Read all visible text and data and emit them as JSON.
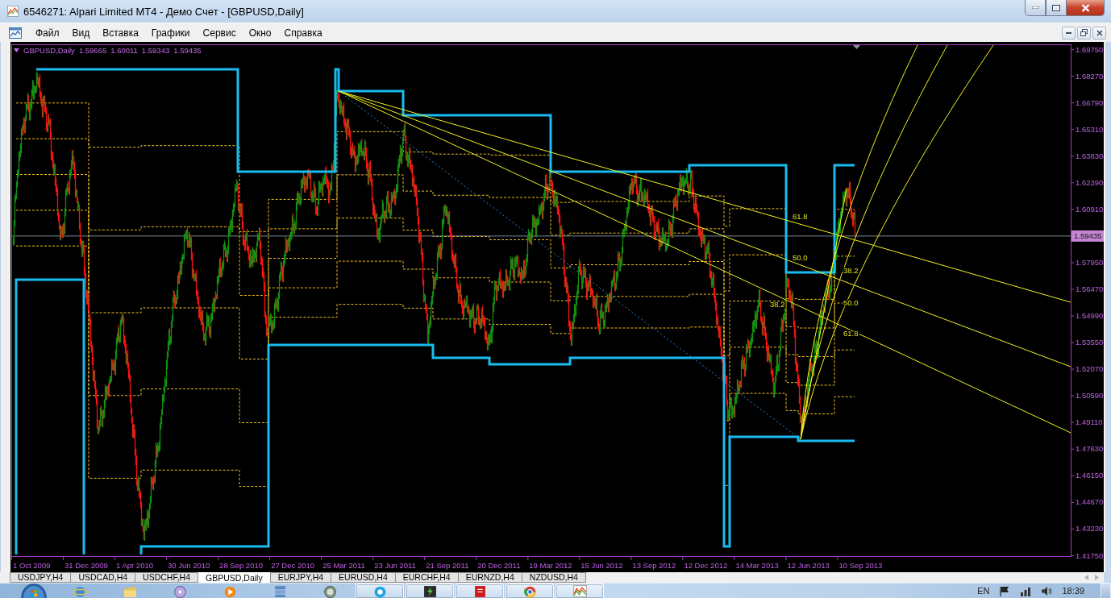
{
  "window": {
    "title": "6546271: Alpari Limited MT4 - Демо Счет - [GBPUSD,Daily]"
  },
  "menu": [
    "Файл",
    "Вид",
    "Вставка",
    "Графики",
    "Сервис",
    "Окно",
    "Справка"
  ],
  "chart": {
    "symbol": "GBPUSD,Daily",
    "quotes": [
      "1.59665",
      "1.60011",
      "1.59343",
      "1.59435"
    ],
    "price_labels": [
      {
        "text": "1.69750",
        "current": false
      },
      {
        "text": "1.68270",
        "current": false
      },
      {
        "text": "1.66790",
        "current": false
      },
      {
        "text": "1.65310",
        "current": false
      },
      {
        "text": "1.63830",
        "current": false
      },
      {
        "text": "1.62390",
        "current": false
      },
      {
        "text": "1.60910",
        "current": false
      },
      {
        "text": "1.59435",
        "current": true
      },
      {
        "text": "1.57950",
        "current": false
      },
      {
        "text": "1.56470",
        "current": false
      },
      {
        "text": "1.54990",
        "current": false
      },
      {
        "text": "1.53550",
        "current": false
      },
      {
        "text": "1.52070",
        "current": false
      },
      {
        "text": "1.50590",
        "current": false
      },
      {
        "text": "1.49110",
        "current": false
      },
      {
        "text": "1.47630",
        "current": false
      },
      {
        "text": "1.46150",
        "current": false
      },
      {
        "text": "1.44670",
        "current": false
      },
      {
        "text": "1.43230",
        "current": false
      },
      {
        "text": "1.41750",
        "current": false
      }
    ],
    "date_labels": [
      "1 Oct 2009",
      "31 Dec 2009",
      "1 Apr 2010",
      "30 Jun 2010",
      "28 Sep 2010",
      "27 Dec 2010",
      "25 Mar 2011",
      "23 Jun 2011",
      "21 Sep 2011",
      "20 Dec 2011",
      "19 Mar 2012",
      "15 Jun 2012",
      "13 Sep 2012",
      "12 Dec 2012",
      "14 Mar 2013",
      "12 Jun 2013",
      "10 Sep 2013"
    ],
    "fans": [
      {
        "labels": [
          "61.8",
          "50.0",
          "38.2"
        ]
      },
      {
        "labels": [
          "38.2",
          "50.0",
          "61.8"
        ]
      }
    ]
  },
  "tabs": [
    {
      "label": "USDJPY,H4",
      "selected": false
    },
    {
      "label": "USDCAD,H4",
      "selected": false
    },
    {
      "label": "USDCHF,H4",
      "selected": false
    },
    {
      "label": "GBPUSD,Daily",
      "selected": true
    },
    {
      "label": "EURJPY,H4",
      "selected": false
    },
    {
      "label": "EURUSD,H4",
      "selected": false
    },
    {
      "label": "EURCHF,H4",
      "selected": false
    },
    {
      "label": "EURNZD,H4",
      "selected": false
    },
    {
      "label": "NZDUSD,H4",
      "selected": false
    }
  ],
  "taskbar": {
    "buttons": [
      {
        "running": false
      },
      {
        "running": false
      },
      {
        "running": false
      },
      {
        "running": false
      },
      {
        "running": false
      },
      {
        "running": false
      },
      {
        "running": true
      },
      {
        "running": true
      },
      {
        "running": true
      },
      {
        "running": true
      },
      {
        "running": true
      }
    ],
    "language": "EN",
    "clock": "18:39"
  }
}
